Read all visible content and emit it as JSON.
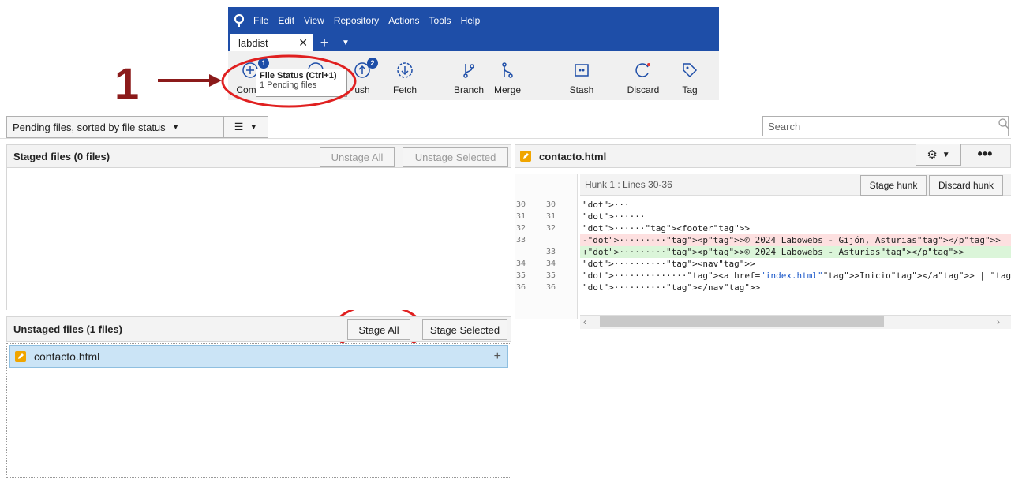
{
  "menu": {
    "items": [
      "File",
      "Edit",
      "View",
      "Repository",
      "Actions",
      "Tools",
      "Help"
    ]
  },
  "tab": {
    "name": "labdist"
  },
  "toolbar": {
    "commit_label": "Comm",
    "commit_badge": "1",
    "push_label": "ush",
    "push_badge": "2",
    "fetch_label": "Fetch",
    "branch_label": "Branch",
    "merge_label": "Merge",
    "stash_label": "Stash",
    "discard_label": "Discard",
    "tag_label": "Tag"
  },
  "tooltip": {
    "title": "File Status (Ctrl+1)",
    "subtitle": "1 Pending files"
  },
  "annotations": {
    "one": "1",
    "two": "2"
  },
  "filterbar": {
    "sort_value": "Pending files, sorted by file status",
    "search_placeholder": "Search"
  },
  "staged": {
    "title": "Staged files  (0 files)",
    "unstage_all": "Unstage All",
    "unstage_selected": "Unstage Selected"
  },
  "unstaged": {
    "title": "Unstaged files  (1 files)",
    "stage_all": "Stage All",
    "stage_selected": "Stage Selected",
    "files": [
      {
        "name": "contacto.html"
      }
    ]
  },
  "diff": {
    "file_name": "contacto.html",
    "hunk_title": "Hunk 1 : Lines 30-36",
    "stage_hunk": "Stage hunk",
    "discard_hunk": "Discard hunk",
    "lines": [
      {
        "old": "30",
        "new": "30",
        "type": "ctx",
        "text": "···"
      },
      {
        "old": "31",
        "new": "31",
        "type": "ctx",
        "text": "······"
      },
      {
        "old": "32",
        "new": "32",
        "type": "ctx",
        "text": "······<footer>"
      },
      {
        "old": "33",
        "new": "",
        "type": "del",
        "text": "-·········<p>© 2024 Labowebs - Gijón, Asturias</p>"
      },
      {
        "old": "",
        "new": "33",
        "type": "add",
        "text": "+·········<p>© 2024 Labowebs - Asturias</p>"
      },
      {
        "old": "34",
        "new": "34",
        "type": "ctx",
        "text": "··········<nav>"
      },
      {
        "old": "35",
        "new": "35",
        "type": "ctx",
        "text": "··············<a href=\"index.html\">Inicio</a> | <a href=\"contacto.ht"
      },
      {
        "old": "36",
        "new": "36",
        "type": "ctx",
        "text": "··········</nav>"
      }
    ]
  },
  "colors": {
    "accent": "#1e4ea8",
    "annotation": "#8b1a1a",
    "selection": "#cbe4f6"
  }
}
